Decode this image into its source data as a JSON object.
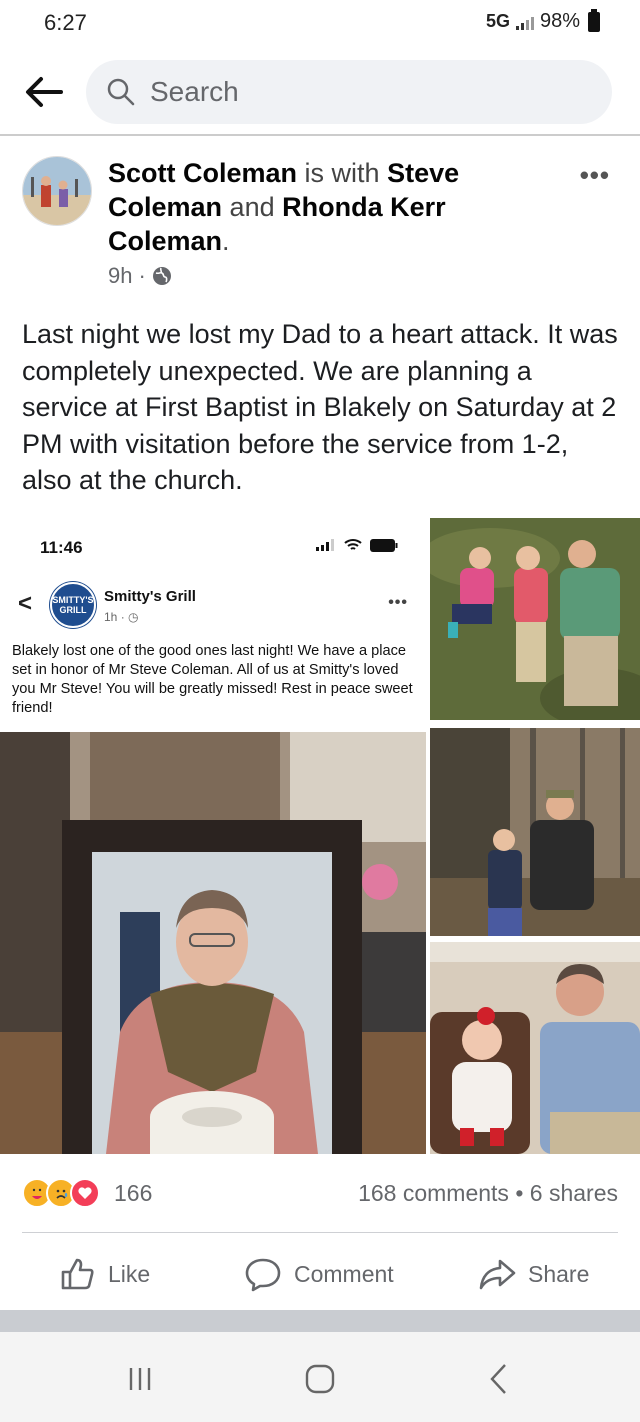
{
  "status_bar": {
    "time": "6:27",
    "network": "5G",
    "battery": "98%"
  },
  "header": {
    "search_placeholder": "Search"
  },
  "post": {
    "author": "Scott Coleman",
    "with_text": "is with",
    "tagged_1": "Steve Coleman",
    "and_text": "and",
    "tagged_2": "Rhonda Kerr Coleman",
    "period": ".",
    "time": "9h",
    "dot": "·",
    "text": "Last night we lost my Dad to a heart attack. It was completely unexpected. We are planning a service at First Baptist in Blakely on Saturday at 2 PM with visitation before the service from 1-2, also at the church."
  },
  "embedded_post": {
    "status_time": "11:46",
    "page_name": "Smitty's Grill",
    "logo_text": "SMITTY'S GRILL",
    "time": "1h",
    "dot": "·",
    "text": "Blakely lost one of the good ones last night! We have a place set in honor of Mr Steve Coleman. All of us at Smitty's loved you Mr Steve! You will be greatly missed! Rest in peace sweet friend!"
  },
  "engagement": {
    "reaction_count": "166",
    "comments": "168 comments",
    "separator": "•",
    "shares": "6 shares",
    "reaction_icons": [
      "care-reaction-icon",
      "sad-reaction-icon",
      "love-reaction-icon"
    ]
  },
  "actions": {
    "like": "Like",
    "comment": "Comment",
    "share": "Share"
  },
  "colors": {
    "meta_gray": "#65676b",
    "search_bg": "#f0f2f5",
    "divider": "#ced0d4"
  }
}
